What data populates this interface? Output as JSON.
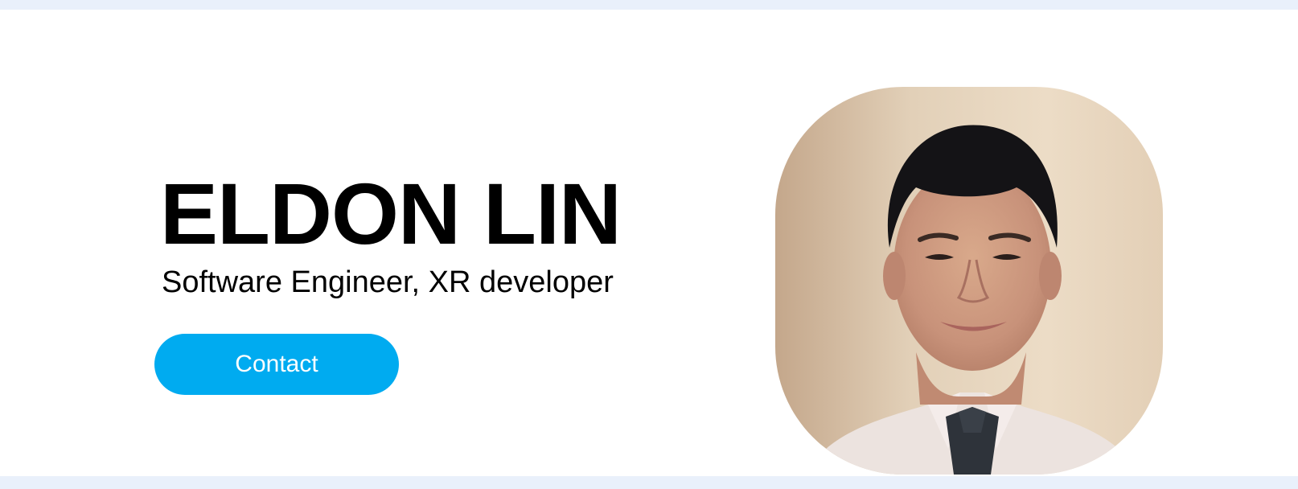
{
  "hero": {
    "name": "ELDON LIN",
    "role": "Software Engineer, XR developer",
    "contact_label": "Contact"
  },
  "colors": {
    "page_background": "#e9f0fb",
    "hero_background": "#ffffff",
    "accent": "#00abf0",
    "text": "#000000"
  }
}
